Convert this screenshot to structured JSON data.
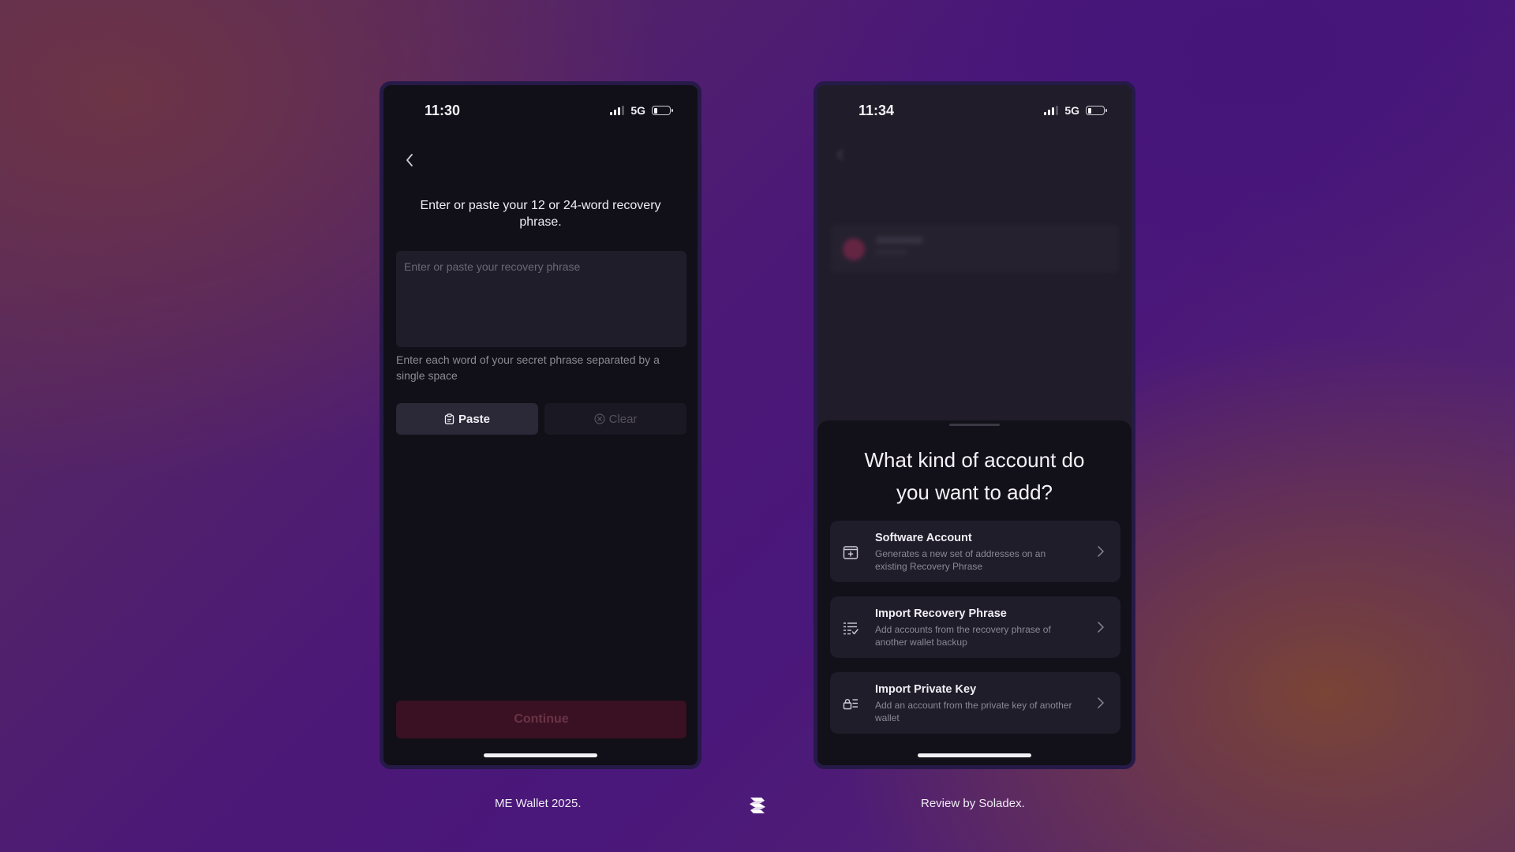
{
  "left_phone": {
    "status": {
      "time": "11:30",
      "network": "5G"
    },
    "heading": "Enter or paste your 12 or 24-word recovery phrase.",
    "input": {
      "placeholder": "Enter or paste your recovery phrase",
      "value": ""
    },
    "helper": "Enter each word of your secret phrase separated by a single space",
    "paste_label": "Paste",
    "clear_label": "Clear",
    "continue_label": "Continue"
  },
  "right_phone": {
    "status": {
      "time": "11:34",
      "network": "5G"
    },
    "sheet": {
      "title": "What kind of account do you want to add?",
      "options": [
        {
          "title": "Software Account",
          "description": "Generates a new set of addresses on an existing Recovery Phrase",
          "icon": "add-wallet-icon"
        },
        {
          "title": "Import Recovery Phrase",
          "description": "Add accounts from the recovery phrase of another wallet backup",
          "icon": "list-check-icon"
        },
        {
          "title": "Import Private Key",
          "description": "Add an account from the private key of another wallet",
          "icon": "key-card-icon"
        }
      ]
    }
  },
  "footer": {
    "left": "ME Wallet 2025.",
    "right": "Review by Soladex.",
    "logo": "soladex-logo"
  },
  "colors": {
    "continue_bg": "#3a1122",
    "sheet_bg": "#121019",
    "card_bg": "#201d2a"
  }
}
